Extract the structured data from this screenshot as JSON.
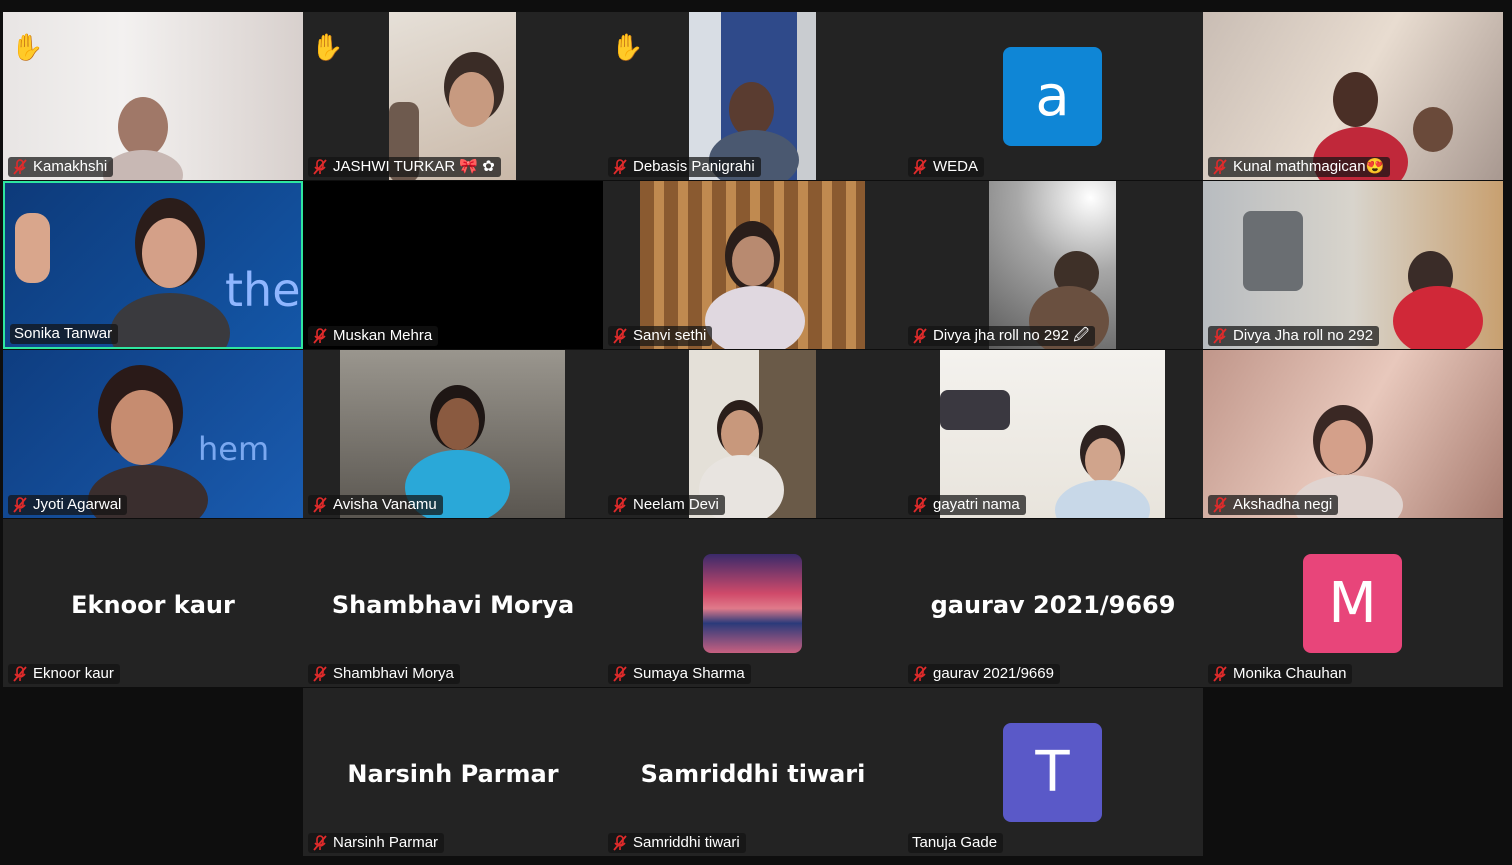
{
  "participants": [
    {
      "name": "Kamakhshi",
      "raised_hand": true,
      "muted": true
    },
    {
      "name": "JASHWI TURKAR 🎀 ✿",
      "raised_hand": true,
      "muted": true
    },
    {
      "name": "Debasis Panigrahi",
      "raised_hand": true,
      "muted": true
    },
    {
      "name": "WEDA",
      "muted": true,
      "avatar_letter": "a",
      "avatar_color": "#0f86d6"
    },
    {
      "name": "Kunal mathmagican😍",
      "muted": true
    },
    {
      "name": "Sonika Tanwar",
      "muted": false,
      "active_speaker": true,
      "accent": "#2ee6a0"
    },
    {
      "name": "Muskan Mehra",
      "muted": true
    },
    {
      "name": "Sanvi sethi",
      "muted": true
    },
    {
      "name": "Divya jha roll no 292 🖉",
      "muted": true
    },
    {
      "name": "Divya Jha roll no 292",
      "muted": true
    },
    {
      "name": "Jyoti Agarwal",
      "muted": true
    },
    {
      "name": "Avisha Vanamu",
      "muted": true
    },
    {
      "name": "Neelam Devi",
      "muted": true
    },
    {
      "name": "gayatri nama",
      "muted": true
    },
    {
      "name": "Akshadha negi",
      "muted": true
    },
    {
      "name": "Eknoor kaur",
      "muted": true,
      "display_name": "Eknoor kaur"
    },
    {
      "name": "Shambhavi Morya",
      "muted": true,
      "display_name": "Shambhavi Morya"
    },
    {
      "name": "Sumaya Sharma",
      "muted": true
    },
    {
      "name": "gaurav 2021/9669",
      "muted": true,
      "display_name": "gaurav 2021/9669"
    },
    {
      "name": "Monika Chauhan",
      "muted": true,
      "avatar_letter": "M",
      "avatar_color": "#e8457a"
    },
    {
      "name": "Narsinh Parmar",
      "muted": true,
      "display_name": "Narsinh Parmar"
    },
    {
      "name": "Samriddhi tiwari",
      "muted": true,
      "display_name": "Samriddhi tiwari"
    },
    {
      "name": "Tanuja Gade",
      "muted": false,
      "avatar_letter": "T",
      "avatar_color": "#5a59c8"
    }
  ],
  "icons": {
    "raised_hand": "raised-hand-icon",
    "muted": "mic-muted-icon"
  },
  "colors": {
    "background": "#0e0e0e",
    "tile": "#232323",
    "muted_mic": "#e02b2b"
  }
}
